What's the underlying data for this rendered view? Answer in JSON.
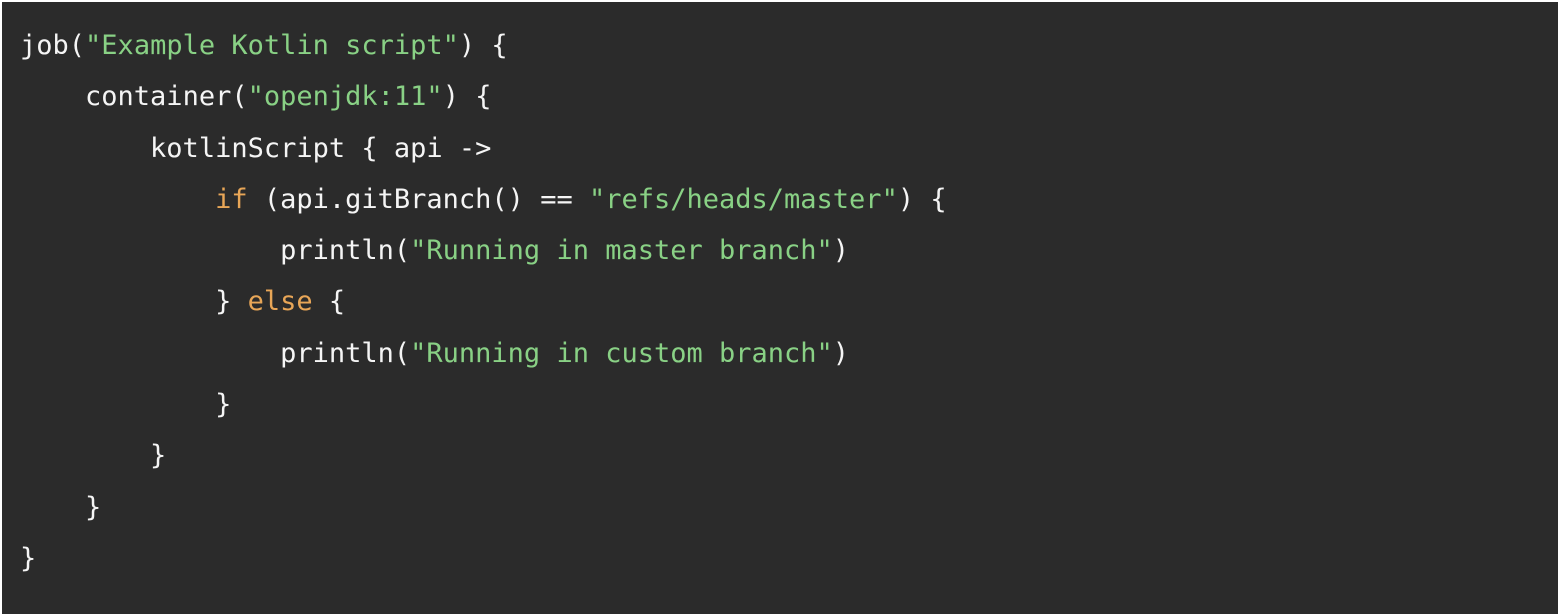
{
  "code": {
    "fn_job": "job",
    "str_jobname": "\"Example Kotlin script\"",
    "punc_open_job": ") {",
    "indent1": "    ",
    "fn_container": "container",
    "str_image": "\"openjdk:11\"",
    "punc_open_container": ") {",
    "indent2": "        ",
    "id_kotlinScript": "kotlinScript { api ->",
    "indent3": "            ",
    "kw_if": "if",
    "cond_open": " (api.gitBranch() == ",
    "str_branch": "\"refs/heads/master\"",
    "cond_close": ") {",
    "indent4": "                ",
    "fn_println1": "println(",
    "str_msg1": "\"Running in master branch\"",
    "close_paren1": ")",
    "close_if": "} ",
    "kw_else": "else",
    "open_else": " {",
    "fn_println2": "println(",
    "str_msg2": "\"Running in custom branch\"",
    "close_paren2": ")",
    "close_else": "}",
    "close_ks": "}",
    "close_container": "}",
    "close_job": "}"
  }
}
